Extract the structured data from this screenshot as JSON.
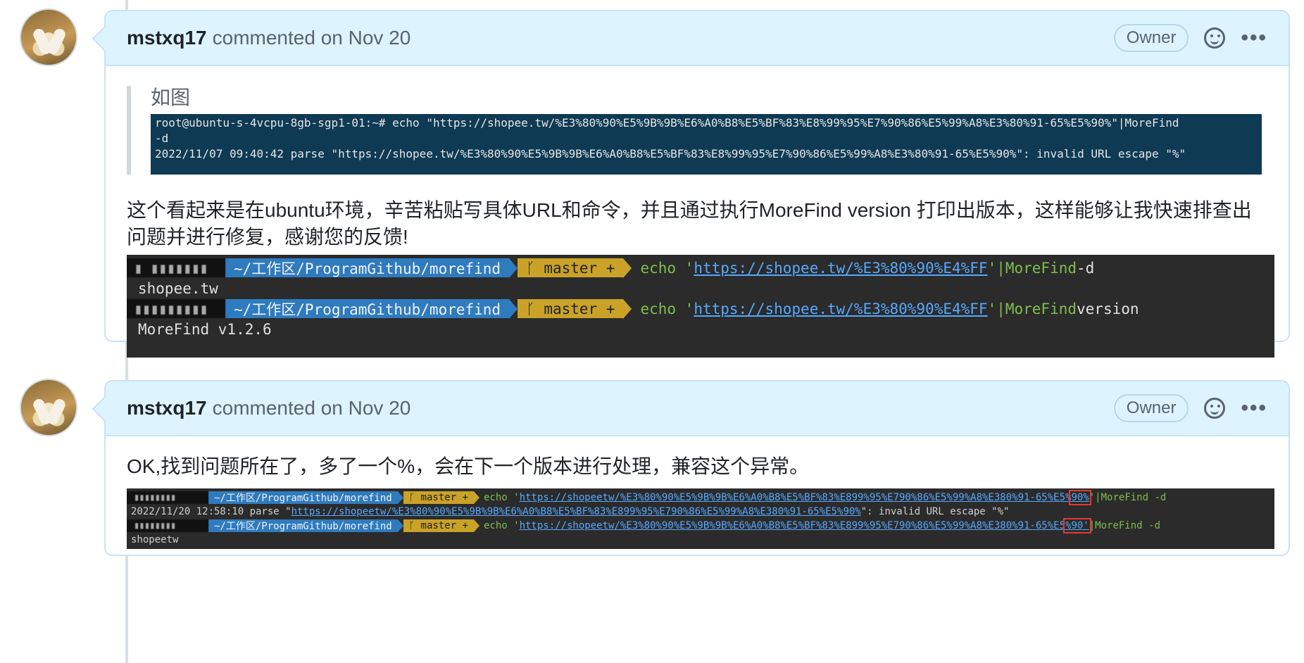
{
  "comments": [
    {
      "author": "mstxq17",
      "meta": "commented on Nov 20",
      "badge": "Owner",
      "quote": "如图",
      "term1_lines": [
        "root@ubuntu-s-4vcpu-8gb-sgp1-01:~# echo \"https://shopee.tw/%E3%80%90%E5%9B%9B%E6%A0%B8%E5%BF%83%E8%99%95%E7%90%86%E5%99%A8%E3%80%91-65%E5%90%\"|MoreFind",
        "-d",
        "2022/11/07 09:40:42 parse \"https://shopee.tw/%E3%80%90%E5%9B%9B%E6%A0%B8%E5%BF%83%E8%99%95%E7%90%86%E5%99%A8%E3%80%91-65%E5%90%\": invalid URL escape \"%\""
      ],
      "body": "这个看起来是在ubuntu环境，辛苦粘贴写具体URL和命令，并且通过执行MoreFind version 打印出版本，这样能够让我快速排查出问题并进行修复，感谢您的反馈!",
      "term2": {
        "host1": "▮ ▮▮▮▮▮▮▮",
        "host2": "▮▮▮▮▮▮▮▮▮",
        "path": "~/工作区/ProgramGithub/morefind",
        "git": "ᚴ master +",
        "cmd": "echo '",
        "url": "https://shopee.tw/%E3%80%90%E4%FF",
        "quote_end": "'",
        "pipe1": "  |MoreFind",
        "arg1": " -d",
        "out1": "shopee.tw",
        "pipe2": "  |MoreFind",
        "arg2": " version",
        "out2": "MoreFind v1.2.6"
      }
    },
    {
      "author": "mstxq17",
      "meta": "commented on Nov 20",
      "badge": "Owner",
      "body": "OK,找到问题所在了，多了一个%，会在下一个版本进行处理，兼容这个异常。",
      "term3": {
        "host": "▮▮▮▮▮▮▮▮",
        "path": "~/工作区/ProgramGithub/morefind",
        "git": "ᚴ master +",
        "cmd": "echo '",
        "url1_main": "https://shopeetw/%E3%80%90%E5%9B%9B%E6%A0%B8%E5%BF%83%E899%95%E790%86%E5%99%A8%E380%91-65%E5%",
        "url1_hl": "90%",
        "url1_tail": "'",
        "pipe": "|MoreFind -d",
        "out1_pre": "2022/11/20 12:58:10 parse \"",
        "out1_url": "https://shopeetw/%E3%80%90%E5%9B%9B%E6%A0%B8%E5%BF%83%E899%95%E790%86%E5%99%A8%E380%91-65%E5%90%",
        "out1_post": "\": invalid URL escape \"%\"",
        "url2_main": "https://shopeetw/%E3%80%90%E5%9B%9B%E6%A0%B8%E5%BF%83%E899%95%E790%86%E5%99%A8%E380%91-65%E5",
        "url2_hl": "%90'",
        "out2": "shopeetw"
      }
    }
  ]
}
